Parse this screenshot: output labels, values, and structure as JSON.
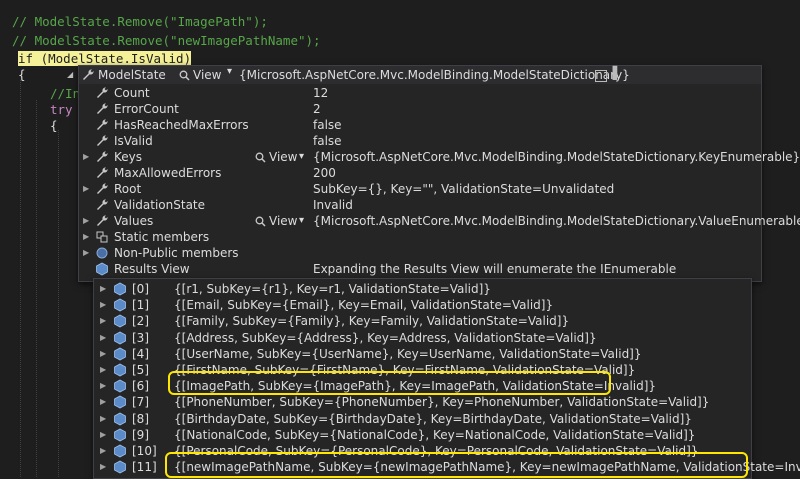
{
  "code": {
    "line1": "// ModelState.Remove(\"ImagePath\");",
    "line2": "// ModelState.Remove(\"newImagePathName\");",
    "if_kw": "if",
    "if_cond": " (ModelState.IsValid)",
    "brace_open": "{",
    "inner_comment": "//In",
    "try_kw": "try",
    "brace_inner": "{"
  },
  "tooltip": {
    "name": "ModelState",
    "view_label": "View",
    "value": "{Microsoft.AspNetCore.Mvc.ModelBinding.ModelStateDictionary}"
  },
  "members": [
    {
      "name": "Count",
      "value": "12",
      "expandable": false,
      "view": ""
    },
    {
      "name": "ErrorCount",
      "value": "2",
      "expandable": false,
      "view": ""
    },
    {
      "name": "HasReachedMaxErrors",
      "value": "false",
      "expandable": false,
      "view": ""
    },
    {
      "name": "IsValid",
      "value": "false",
      "expandable": false,
      "view": ""
    },
    {
      "name": "Keys",
      "value": "{Microsoft.AspNetCore.Mvc.ModelBinding.ModelStateDictionary.KeyEnumerable}",
      "expandable": true,
      "view": "View"
    },
    {
      "name": "MaxAllowedErrors",
      "value": "200",
      "expandable": false,
      "view": ""
    },
    {
      "name": "Root",
      "value": "SubKey={}, Key=\"\", ValidationState=Unvalidated",
      "expandable": true,
      "view": ""
    },
    {
      "name": "ValidationState",
      "value": "Invalid",
      "expandable": false,
      "view": ""
    },
    {
      "name": "Values",
      "value": "{Microsoft.AspNetCore.Mvc.ModelBinding.ModelStateDictionary.ValueEnumerable}",
      "expandable": true,
      "view": "View"
    },
    {
      "name": "Static members",
      "value": "",
      "expandable": true,
      "view": ""
    },
    {
      "name": "Non-Public members",
      "value": "",
      "expandable": true,
      "view": ""
    },
    {
      "name": "Results View",
      "value": "Expanding the Results View will enumerate the IEnumerable",
      "expandable": false,
      "view": ""
    }
  ],
  "results": [
    {
      "index": "[0]",
      "value": "{[r1, SubKey={r1}, Key=r1, ValidationState=Valid]}"
    },
    {
      "index": "[1]",
      "value": "{[Email, SubKey={Email}, Key=Email, ValidationState=Valid]}"
    },
    {
      "index": "[2]",
      "value": "{[Family, SubKey={Family}, Key=Family, ValidationState=Valid]}"
    },
    {
      "index": "[3]",
      "value": "{[Address, SubKey={Address}, Key=Address, ValidationState=Valid]}"
    },
    {
      "index": "[4]",
      "value": "{[UserName, SubKey={UserName}, Key=UserName, ValidationState=Valid]}"
    },
    {
      "index": "[5]",
      "value": "{[FirstName, SubKey={FirstName}, Key=FirstName, ValidationState=Valid]}"
    },
    {
      "index": "[6]",
      "value": "{[ImagePath, SubKey={ImagePath}, Key=ImagePath, ValidationState=Invalid]}"
    },
    {
      "index": "[7]",
      "value": "{[PhoneNumber, SubKey={PhoneNumber}, Key=PhoneNumber, ValidationState=Valid]}"
    },
    {
      "index": "[8]",
      "value": "{[BirthdayDate, SubKey={BirthdayDate}, Key=BirthdayDate, ValidationState=Valid]}"
    },
    {
      "index": "[9]",
      "value": "{[NationalCode, SubKey={NationalCode}, Key=NationalCode, ValidationState=Valid]}"
    },
    {
      "index": "[10]",
      "value": "{[PersonalCode, SubKey={PersonalCode}, Key=PersonalCode, ValidationState=Valid]}"
    },
    {
      "index": "[11]",
      "value": "{[newImagePathName, SubKey={newImagePathName}, Key=newImagePathName, ValidationState=Invalid]}"
    }
  ],
  "colors": {
    "highlight_box": "#ffe600",
    "comment": "#57a64a",
    "keyword": "#c586c0"
  },
  "icons": {
    "property": "wrench-icon",
    "static": "static-members-icon",
    "nonpublic": "non-public-members-icon",
    "results": "cube-icon",
    "view": "magnifier-icon"
  }
}
